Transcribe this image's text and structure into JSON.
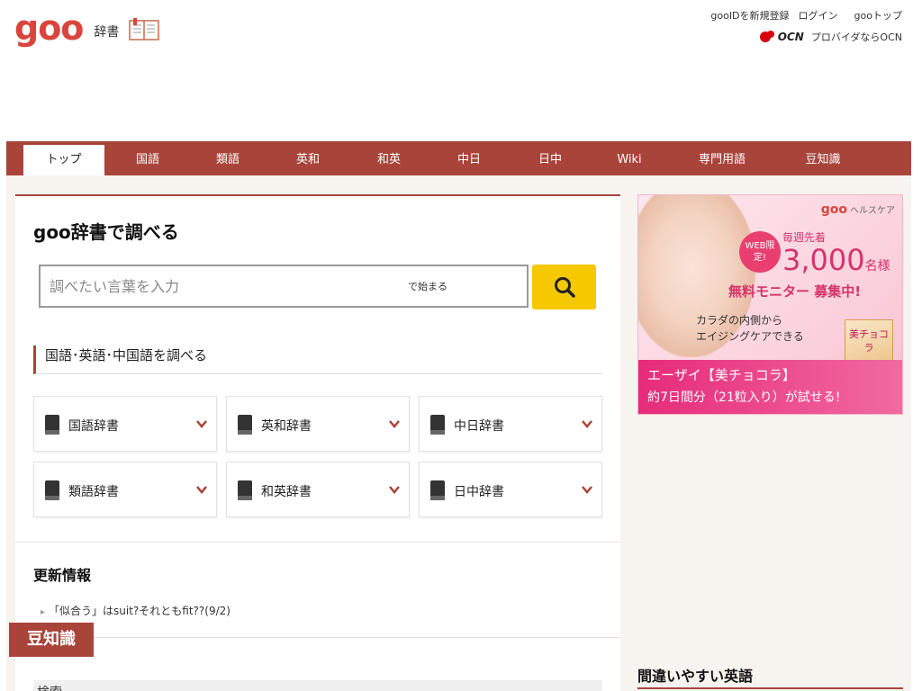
{
  "header": {
    "logo": "goo",
    "logo_sub": "辞書",
    "links": [
      "gooIDを新規登録",
      "ログイン",
      "gooトップ"
    ],
    "ocn_word": "OCN",
    "ocn_text": "プロバイダならOCN"
  },
  "nav": {
    "items": [
      "トップ",
      "国語",
      "類語",
      "英和",
      "和英",
      "中日",
      "日中",
      "Wiki",
      "専門用語",
      "豆知識"
    ],
    "active": "トップ"
  },
  "main": {
    "title": "goo辞書で調べる",
    "search": {
      "placeholder": "調べたい言葉を入力",
      "mode": "で始まる"
    },
    "section_title": "国語･英語･中国語を調べる",
    "dicts": [
      "国語辞書",
      "英和辞書",
      "中日辞書",
      "類語辞書",
      "和英辞書",
      "日中辞書"
    ],
    "update_title": "更新情報",
    "update_item": "「似合う」はsuit?それともfit??(9/2)",
    "grey_block_text": "検索",
    "mame_tab": "豆知識"
  },
  "ad": {
    "brand": "goo",
    "brand_sub": "ヘルスケア",
    "web_badge": "WEB限定!",
    "line1": "毎週先着",
    "big_number": "3,000",
    "big_unit": "名様",
    "monitor": "無料モニター 募集中!",
    "line3a": "カラダの内側から",
    "line3b": "エイジングケアできる",
    "pack": "美チョコラ",
    "band1": "エーザイ【美チョコラ】",
    "band2": "約7日間分（21粒入り）が試せる!"
  },
  "side": {
    "title": "間違いやすい英語"
  },
  "colors": {
    "accent": "#a8443a",
    "logo": "#d9453c",
    "search_button": "#f5c800"
  }
}
